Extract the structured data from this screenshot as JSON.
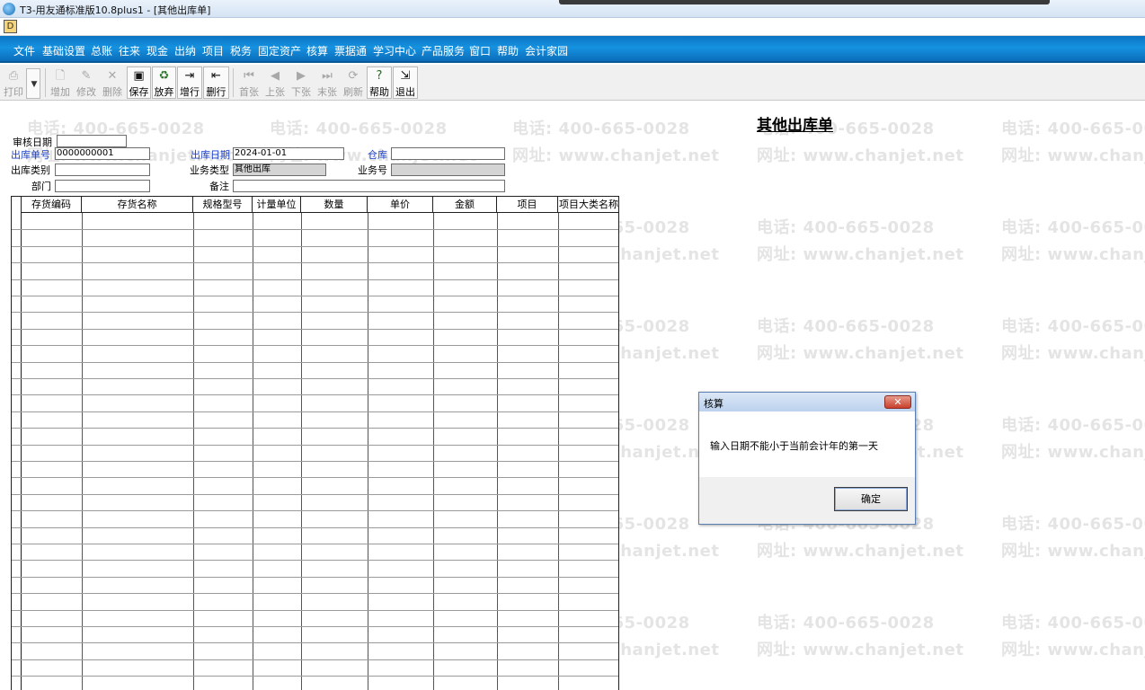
{
  "window": {
    "title": "T3-用友通标准版10.8plus1 - [其他出库单]"
  },
  "subbar": {
    "doc_icon": "D"
  },
  "menu": [
    "文件",
    "基础设置",
    "总账",
    "往来",
    "现金",
    "出纳",
    "项目",
    "税务",
    "固定资产",
    "核算",
    "票据通",
    "学习中心",
    "产品服务",
    "窗口",
    "帮助",
    "会计家园"
  ],
  "toolbar": {
    "print": "打印",
    "add": "增加",
    "edit": "修改",
    "delete": "删除",
    "save": "保存",
    "discard": "放弃",
    "insert_row": "增行",
    "delete_row": "删行",
    "first": "首张",
    "prev": "上张",
    "next": "下张",
    "last": "末张",
    "refresh": "刷新",
    "help": "帮助",
    "exit": "退出"
  },
  "form": {
    "title": "其他出库单",
    "audit_date_label": "审核日期",
    "audit_date": "",
    "out_no_label": "出库单号",
    "out_no": "0000000001",
    "out_date_label": "出库日期",
    "out_date": "2024-01-01",
    "warehouse_label": "仓库",
    "warehouse": "",
    "out_type_label": "出库类别",
    "out_type": "",
    "biz_type_label": "业务类型",
    "biz_type": "其他出库",
    "biz_no_label": "业务号",
    "biz_no": "",
    "dept_label": "部门",
    "dept": "",
    "remark_label": "备注",
    "remark": ""
  },
  "grid": {
    "columns": [
      "存货编码",
      "存货名称",
      "规格型号",
      "计量单位",
      "数量",
      "单价",
      "金额",
      "项目",
      "项目大类名称"
    ]
  },
  "watermark": {
    "phone": "电话: 400-665-0028",
    "site": "网址: www.chanjet.net"
  },
  "dialog": {
    "title": "核算",
    "message": "输入日期不能小于当前会计年的第一天",
    "ok": "确定",
    "close": "✕"
  }
}
